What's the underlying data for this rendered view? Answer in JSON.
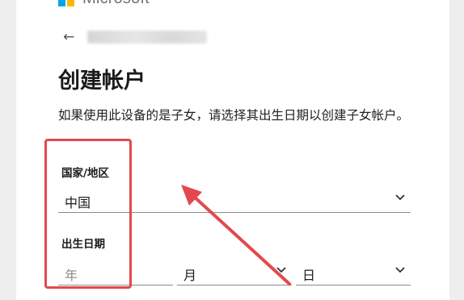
{
  "brand": {
    "name": "Microsoft",
    "colors": [
      "#f25022",
      "#7fba00",
      "#00a4ef",
      "#ffb900"
    ]
  },
  "nav": {
    "back_icon": "back-arrow-icon"
  },
  "page": {
    "title": "创建帐户",
    "description": "如果使用此设备的是子女，请选择其出生日期以创建子女帐户。"
  },
  "country_field": {
    "label": "国家/地区",
    "value": "中国"
  },
  "birthdate_field": {
    "label": "出生日期",
    "year_placeholder": "年",
    "month_placeholder": "月",
    "day_placeholder": "日"
  },
  "annotation": {
    "color": "#e2494e"
  }
}
